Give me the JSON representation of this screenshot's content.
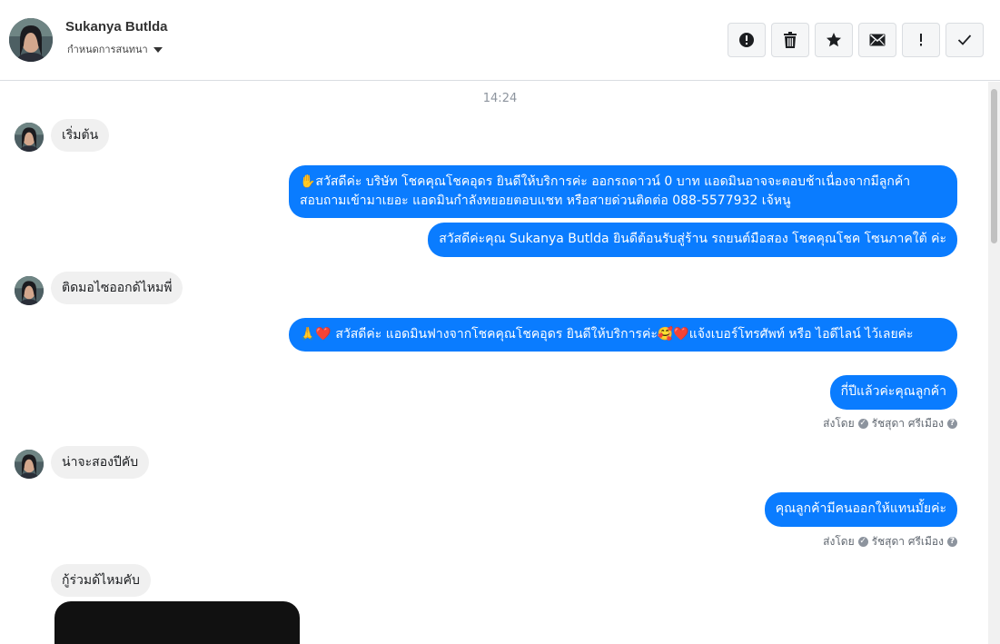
{
  "header": {
    "contact_name": "Sukanya Butlda",
    "conversation_settings": "กำหนดการสนทนา",
    "actions": [
      {
        "name": "report-spam-button",
        "icon": "alert-circle-icon"
      },
      {
        "name": "delete-button",
        "icon": "trash-icon"
      },
      {
        "name": "star-button",
        "icon": "star-icon"
      },
      {
        "name": "mark-unread-button",
        "icon": "envelope-icon"
      },
      {
        "name": "follow-up-button",
        "icon": "exclamation-icon"
      },
      {
        "name": "mark-done-button",
        "icon": "checkmark-icon"
      }
    ]
  },
  "thread": {
    "timestamp": "14:24",
    "messages": [
      {
        "from": "customer",
        "text": "เริ่มต้น"
      },
      {
        "from": "page",
        "text": "✋สวัสดีค่ะ บริษัท โชคคุณโชคอุดร ยินดีให้บริการค่ะ ออกรถดาวน์ 0 บาท แอดมินอาจจะตอบช้าเนื่องจากมีลูกค้าสอบถามเข้ามาเยอะ แอดมินกำลังทยอยตอบแชท หรือสายด่วนติดต่อ 088-5577932 เจ้หนู"
      },
      {
        "from": "page",
        "text": "สวัสดีค่ะคุณ Sukanya Butlda ยินดีต้อนรับสู่ร้าน รถยนต์มือสอง โชคคุณโชค โซนภาคใต้ ค่ะ"
      },
      {
        "from": "customer",
        "text": "ติดมอไซออกด้ไหมพี่"
      },
      {
        "from": "page",
        "text": "🙏❤️ สวัสดีค่ะ แอดมินฟางจากโชคคุณโชคอุดร ยินดีให้บริการค่ะ🥰❤️แจ้งเบอร์โทรศัพท์ หรือ ไอดีไลน์  ไว้เลยค่ะ"
      },
      {
        "from": "page",
        "text": "กี่ปีแล้วค่ะคุณลูกค้า"
      },
      {
        "from": "customer",
        "text": "น่าจะสองปีคับ"
      },
      {
        "from": "page",
        "text": "คุณลูกค้ามีคนออกให้แทนมั้ยค่ะ"
      },
      {
        "from": "customer",
        "text": "กู้ร่วมด้ไหมคับ"
      }
    ],
    "sent_by_label": "ส่งโดย",
    "sender_name": "รัชสุดา ศรีเมือง",
    "help_icon": "question-circle-icon",
    "sender_icon": "check-circle-icon"
  }
}
